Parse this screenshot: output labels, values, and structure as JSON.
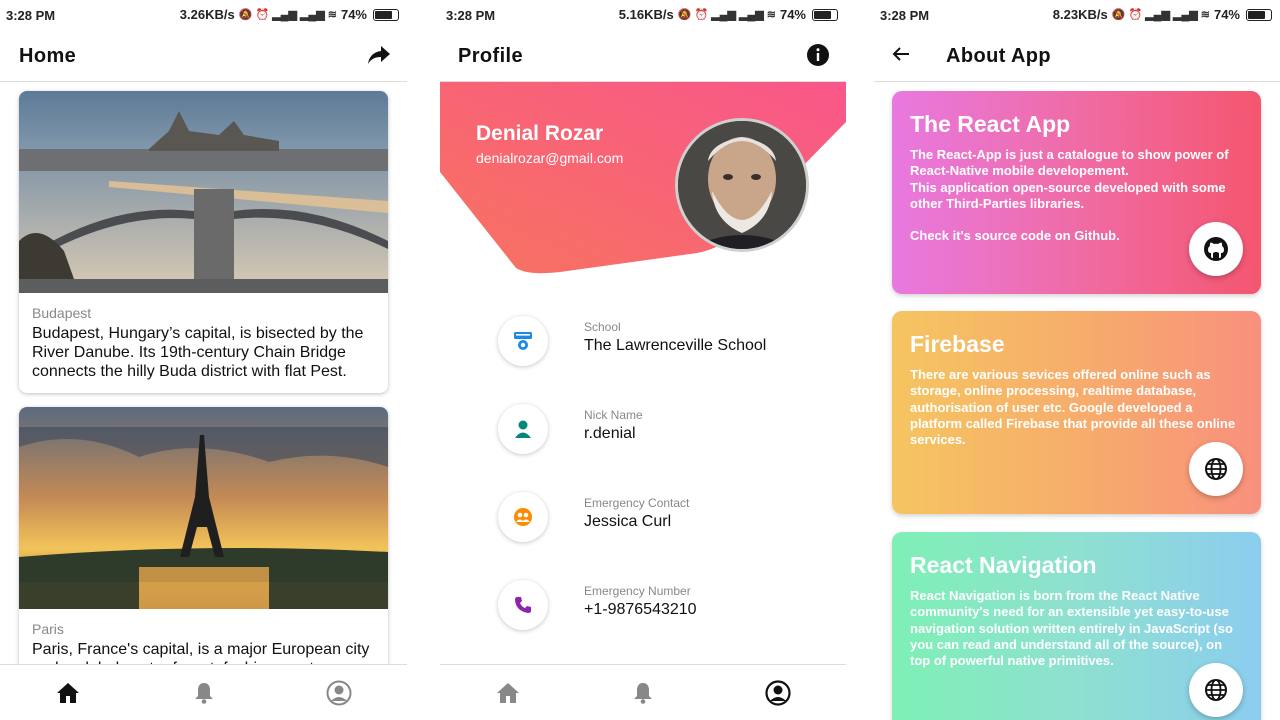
{
  "status_left": {
    "time": "3:28 PM",
    "speed": "3.26KB/s",
    "battery": "74%"
  },
  "status_mid": {
    "time": "3:28 PM",
    "speed": "5.16KB/s",
    "battery": "74%"
  },
  "status_right": {
    "time": "3:28 PM",
    "speed": "8.23KB/s",
    "battery": "74%"
  },
  "home": {
    "title": "Home",
    "cards": [
      {
        "city": "Budapest",
        "desc": "Budapest, Hungary’s capital, is bisected by the River Danube. Its 19th-century Chain Bridge connects the hilly Buda district with flat Pest."
      },
      {
        "city": "Paris",
        "desc": "Paris, France's capital, is a major European city and a global center for art, fashion, gastronomy and culture."
      }
    ]
  },
  "profile": {
    "title": "Profile",
    "name": "Denial Rozar",
    "email": "denialrozar@gmail.com",
    "fields": [
      {
        "label": "School",
        "value": "The Lawrenceville School"
      },
      {
        "label": "Nick Name",
        "value": "r.denial"
      },
      {
        "label": "Emergency Contact",
        "value": "Jessica Curl"
      },
      {
        "label": "Emergency Number",
        "value": "+1-9876543210"
      }
    ]
  },
  "about": {
    "title": "About App",
    "cards": [
      {
        "title": "The React App",
        "text": "The React-App is just a catalogue to show power of React-Native mobile developement.\nThis application open-source developed with some other Third-Parties libraries.\n\nCheck it's source code on Github."
      },
      {
        "title": "Firebase",
        "text": "There are various sevices offered online such as storage, online processing, realtime database, authorisation of user etc. Google developed a platform called Firebase that provide all these online services."
      },
      {
        "title": "React Navigation",
        "text": "React Navigation is born from the React Native community's need for an extensible yet easy-to-use navigation solution written entirely in JavaScript (so you can read and understand all of the source), on top of powerful native primitives."
      }
    ]
  },
  "colors": {
    "accent_pink": "#f5437e",
    "accent_coral": "#fa6a6a",
    "text_dark": "#111111"
  },
  "icons": [
    "share-icon",
    "info-icon",
    "back-arrow-icon",
    "home-icon",
    "bell-icon",
    "user-circle-icon",
    "github-icon",
    "globe-icon"
  ]
}
